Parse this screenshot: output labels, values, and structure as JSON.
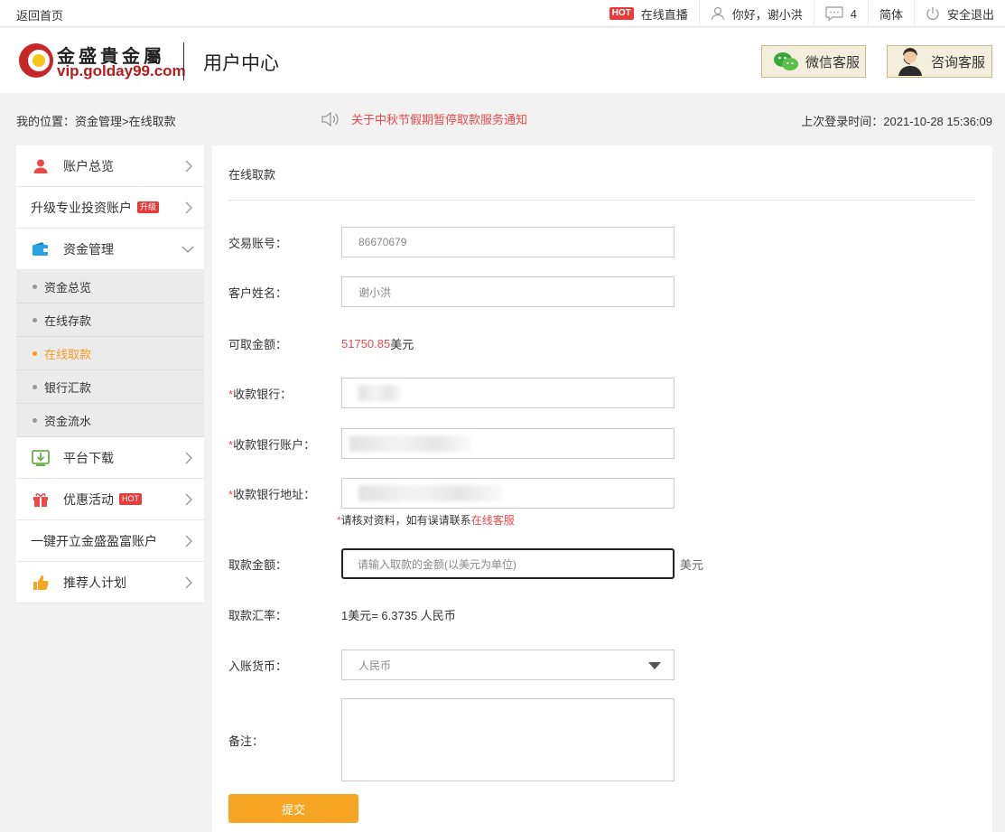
{
  "topbar": {
    "home_link": "返回首页",
    "hot_badge": "HOT",
    "live_label": "在线直播",
    "greeting": "你好，谢小洪",
    "messages_count": "4",
    "language": "简体",
    "logout": "安全退出"
  },
  "header": {
    "logo_cn": "金盛貴金屬",
    "logo_url": "vip.golday99.com",
    "title": "用户中心",
    "wechat_service": "微信客服",
    "consult_service": "咨询客服"
  },
  "breadcrumb": "我的位置：资金管理>在线取款",
  "notice": "关于中秋节假期暂停取款服务通知",
  "last_login": "上次登录时间：2021-10-28 15:36:09",
  "sidebar": {
    "items": [
      {
        "label": "账户总览",
        "icon": "user-icon"
      },
      {
        "label": "升级专业投资账户",
        "badge": "升级"
      },
      {
        "label": "资金管理",
        "icon": "wallet-icon",
        "expanded": true
      },
      {
        "label": "平台下载",
        "icon": "download-icon"
      },
      {
        "label": "优惠活动",
        "icon": "gift-icon",
        "badge": "HOT"
      },
      {
        "label": "一键开立金盛盈富账户"
      },
      {
        "label": "推荐人计划",
        "icon": "thumbs-up-icon"
      }
    ],
    "sub_items": [
      {
        "label": "资金总览"
      },
      {
        "label": "在线存款"
      },
      {
        "label": "在线取款",
        "active": true
      },
      {
        "label": "银行汇款"
      },
      {
        "label": "资金流水"
      }
    ]
  },
  "form": {
    "title": "在线取款",
    "account_label": "交易账号：",
    "account_value": "86670679",
    "name_label": "客户姓名：",
    "name_value": "谢小洪",
    "available_label": "可取金额：",
    "available_amount": "51750.85",
    "available_unit": "美元",
    "required_mark": "*",
    "bank_label": "收款银行：",
    "bank_account_label": "收款银行账户：",
    "bank_address_label": "收款银行地址：",
    "tip_text": "请核对资料，如有误请联系",
    "tip_link": "在线客服",
    "amount_label": "取款金额：",
    "amount_placeholder": "请输入取款的金额(以美元为单位)",
    "amount_unit": "美元",
    "rate_label": "取款汇率：",
    "rate_value": "1美元= 6.3735 人民币",
    "currency_label": "入账货币：",
    "currency_value": "人民币",
    "remark_label": "备注：",
    "submit": "提交"
  },
  "colors": {
    "accent_orange": "#f6a623",
    "alert_red": "#e84a4a",
    "active_orange": "#f39c1f"
  }
}
